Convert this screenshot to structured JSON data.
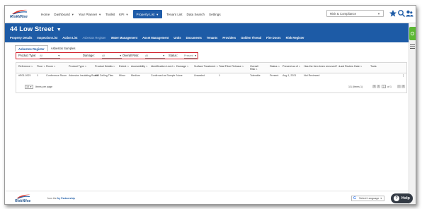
{
  "brand": {
    "logo_text": "RiskWise",
    "colors": {
      "primary": "#1d5ba6",
      "accent_green": "#5cb833",
      "highlight_red": "#d21f2b"
    }
  },
  "topnav": {
    "items": [
      {
        "label": "Home"
      },
      {
        "label": "Dashboard",
        "has_menu": true
      },
      {
        "label": "Your Planner",
        "has_menu": true
      },
      {
        "label": "Toolkit"
      },
      {
        "label": "KPI",
        "has_menu": true
      },
      {
        "label": "Property List",
        "has_menu": true,
        "active": true
      },
      {
        "label": "Tenant List"
      },
      {
        "label": "Data Search"
      },
      {
        "label": "Settings"
      }
    ],
    "org_select": "Risk & Compliance",
    "icons": [
      "star-icon",
      "search-icon",
      "users-icon"
    ]
  },
  "header": {
    "property_title": "44 Low Street",
    "subnav": [
      {
        "label": "Property Details"
      },
      {
        "label": "Inspection List"
      },
      {
        "label": "Action List"
      },
      {
        "label": "Asbestos Register",
        "dim": true
      },
      {
        "label": "Water Management"
      },
      {
        "label": "Asset Management"
      },
      {
        "label": "Units"
      },
      {
        "label": "Documents"
      },
      {
        "label": "Tenants"
      },
      {
        "label": "Providers"
      },
      {
        "label": "Golden Thread"
      },
      {
        "label": "Fire Doors"
      },
      {
        "label": "Risk Register"
      }
    ]
  },
  "tabs": [
    {
      "label": "Asbestos Register",
      "active": true
    },
    {
      "label": "Asbestos Samples"
    }
  ],
  "filters": [
    {
      "label": "Product Type:",
      "value": "All"
    },
    {
      "label": "Damage:",
      "value": "All"
    },
    {
      "label": "Overall Risk:",
      "value": "All"
    },
    {
      "label": "Status:",
      "value": "Present"
    }
  ],
  "table": {
    "columns": [
      "Reference",
      "Floor",
      "Room",
      "Product Type",
      "Product Details",
      "Extent",
      "Accessibility",
      "Identification Level",
      "Damage",
      "Surface Treatment",
      "Total Fibre Release",
      "Overall Risk",
      "Status",
      "Present as of",
      "Has the item been removed?",
      "Last Review Date",
      "Tools"
    ],
    "rows": [
      [
        "#R01-0021",
        "1",
        "Conference Room",
        "Asbestos Insulating Board",
        "AIB Ceiling Tiles",
        "Minor",
        "Medium",
        "Confirmed as Sample",
        "None",
        "Unsealed",
        "1",
        "Tolerable",
        "Present",
        "Aug 1, 2021",
        "Not Reviewed",
        "",
        ""
      ]
    ],
    "pager": {
      "per_page": "10",
      "per_page_label": "Items per page",
      "info": "1/1 (Items 1)",
      "page": "1",
      "of_text": "of 1"
    }
  },
  "footer": {
    "logo_text": "RiskWise",
    "partner_prefix": "from the ",
    "partner_name": "fry Partnership",
    "language": "Select Language",
    "help": "Help"
  }
}
